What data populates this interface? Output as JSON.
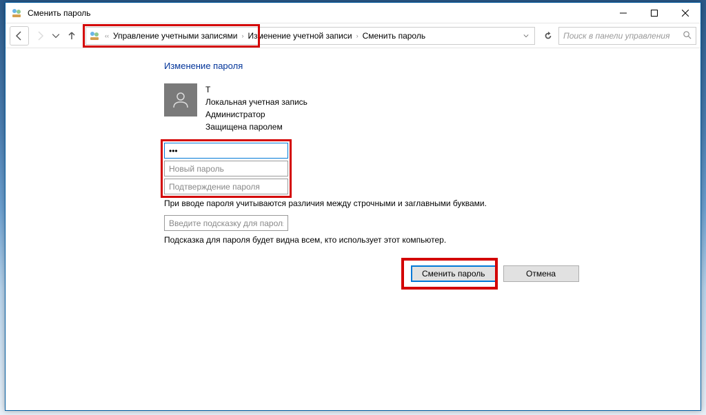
{
  "titlebar": {
    "title": "Сменить пароль"
  },
  "breadcrumb": {
    "items": [
      "Управление учетными записями",
      "Изменение учетной записи",
      "Сменить пароль"
    ]
  },
  "search": {
    "placeholder": "Поиск в панели управления"
  },
  "content": {
    "heading": "Изменение пароля",
    "user": {
      "name": "T",
      "account_type": "Локальная учетная запись",
      "role": "Администратор",
      "status": "Защищена паролем"
    },
    "password_fields": {
      "current_value": "•••",
      "new_placeholder": "Новый пароль",
      "confirm_placeholder": "Подтверждение пароля"
    },
    "note1": "При вводе пароля учитываются различия между строчными и заглавными буквами.",
    "hint_placeholder": "Введите подсказку для пароля",
    "note2": "Подсказка для пароля будет видна всем, кто использует этот компьютер."
  },
  "buttons": {
    "submit": "Сменить пароль",
    "cancel": "Отмена"
  }
}
